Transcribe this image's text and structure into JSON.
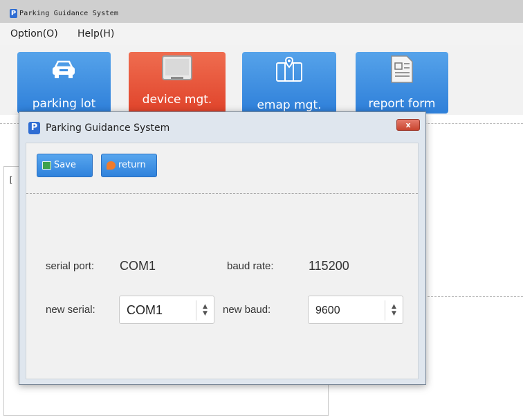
{
  "window": {
    "title": "Parking Guidance System",
    "icon": "parking-p-icon"
  },
  "menu": {
    "items": [
      "Option(O)",
      "Help(H)"
    ]
  },
  "toolbar": {
    "buttons": [
      {
        "label": "parking lot",
        "icon": "car-icon"
      },
      {
        "label": "device mgt.",
        "icon": "monitor-icon",
        "active": true
      },
      {
        "label": "emap mgt.",
        "icon": "map-pin-icon"
      },
      {
        "label": "report form",
        "icon": "document-icon"
      }
    ]
  },
  "tree_panel": {
    "bracket": "["
  },
  "dialog": {
    "title": "Parking Guidance System",
    "close_label": "x",
    "buttons": {
      "save": "Save",
      "return": "return"
    },
    "fields": {
      "serial_port_label": "serial port:",
      "serial_port_value": "COM1",
      "baud_rate_label": "baud rate:",
      "baud_rate_value": "115200",
      "new_serial_label": "new serial:",
      "new_serial_value": "COM1",
      "new_baud_label": "new baud:",
      "new_baud_value": "9600"
    }
  },
  "colors": {
    "toolbar_blue": "#3a8ee3",
    "toolbar_active": "#e54d31",
    "dialog_button_blue": "#4193e6"
  }
}
